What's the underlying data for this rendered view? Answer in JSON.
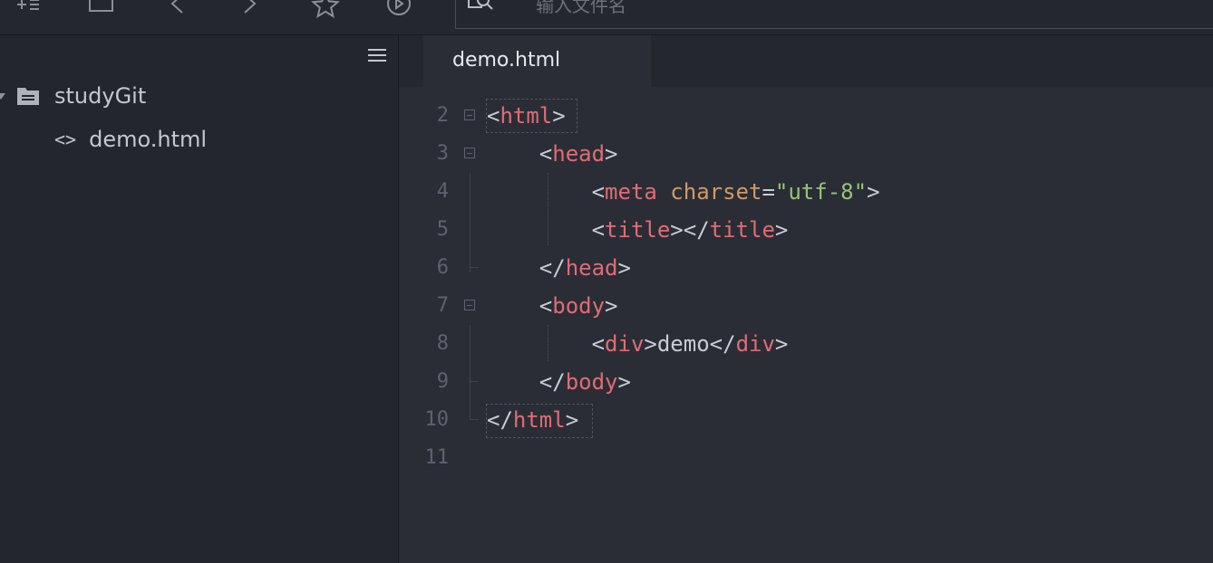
{
  "toolbar": {
    "search_placeholder": "输入文件名",
    "icons": [
      "add-file-icon",
      "square-icon",
      "back-icon",
      "forward-icon",
      "star-icon",
      "play-icon",
      "search-icon"
    ]
  },
  "sidebar": {
    "menu_icon": "hamburger-icon",
    "folder": {
      "name": "studyGit",
      "icon": "folder-icon"
    },
    "files": [
      {
        "name": "demo.html",
        "icon": "code-icon"
      }
    ]
  },
  "editor": {
    "tab": {
      "label": "demo.html"
    },
    "line_numbers": [
      "2",
      "3",
      "4",
      "5",
      "6",
      "7",
      "8",
      "9",
      "10",
      "11"
    ],
    "lines": [
      [
        [
          "p",
          "<"
        ],
        [
          "t",
          "html"
        ],
        [
          "p",
          ">"
        ]
      ],
      [
        [
          "x",
          "    "
        ],
        [
          "p",
          "<"
        ],
        [
          "t",
          "head"
        ],
        [
          "p",
          ">"
        ]
      ],
      [
        [
          "x",
          "        "
        ],
        [
          "p",
          "<"
        ],
        [
          "t",
          "meta"
        ],
        [
          "x",
          " "
        ],
        [
          "a",
          "charset"
        ],
        [
          "p",
          "="
        ],
        [
          "s",
          "\"utf-8\""
        ],
        [
          "p",
          ">"
        ]
      ],
      [
        [
          "x",
          "        "
        ],
        [
          "p",
          "<"
        ],
        [
          "t",
          "title"
        ],
        [
          "p",
          "></"
        ],
        [
          "t",
          "title"
        ],
        [
          "p",
          ">"
        ]
      ],
      [
        [
          "x",
          "    "
        ],
        [
          "p",
          "</"
        ],
        [
          "t",
          "head"
        ],
        [
          "p",
          ">"
        ]
      ],
      [
        [
          "x",
          "    "
        ],
        [
          "p",
          "<"
        ],
        [
          "t",
          "body"
        ],
        [
          "p",
          ">"
        ]
      ],
      [
        [
          "x",
          "        "
        ],
        [
          "p",
          "<"
        ],
        [
          "t",
          "div"
        ],
        [
          "p",
          ">"
        ],
        [
          "x",
          "demo"
        ],
        [
          "p",
          "</"
        ],
        [
          "t",
          "div"
        ],
        [
          "p",
          ">"
        ]
      ],
      [
        [
          "x",
          "    "
        ],
        [
          "p",
          "</"
        ],
        [
          "t",
          "body"
        ],
        [
          "p",
          ">"
        ]
      ],
      [
        [
          "p",
          "</"
        ],
        [
          "t",
          "html"
        ],
        [
          "p",
          ">"
        ]
      ],
      []
    ]
  },
  "colors": {
    "background": "#2a2d35",
    "sidebar": "#23262d",
    "tag": "#e06c75",
    "attribute": "#d19a66",
    "string": "#98c379",
    "text": "#c8ccd4",
    "line_number": "#5c6370"
  }
}
